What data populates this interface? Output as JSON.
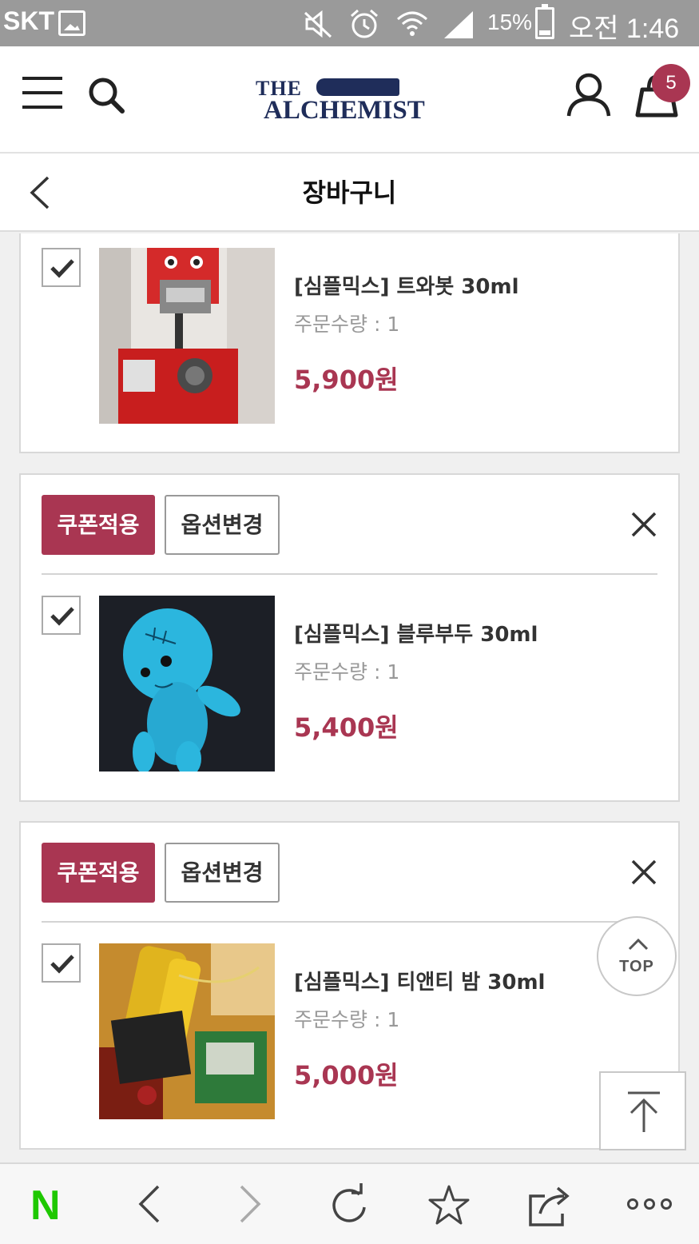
{
  "status_bar": {
    "carrier": "SKT",
    "battery_percent": "15%",
    "time": "오전 1:46",
    "icons": [
      "gallery-icon",
      "mute-icon",
      "alarm-icon",
      "wifi-icon",
      "signal-icon",
      "battery-icon"
    ]
  },
  "header": {
    "logo_line1": "THE",
    "logo_line2": "ALCHEMIST",
    "cart_count": "5",
    "icons": [
      "menu-icon",
      "search-icon",
      "user-icon",
      "cart-icon"
    ]
  },
  "page": {
    "title": "장바구니"
  },
  "cart": {
    "coupon_label": "쿠폰적용",
    "option_label": "옵션변경",
    "items": [
      {
        "name": "[심플믹스] 트와봇 30ml",
        "quantity": "주문수량 : 1",
        "price": "5,900원",
        "checked": true,
        "image": "red-robot"
      },
      {
        "name": "[심플믹스] 블루부두 30ml",
        "quantity": "주문수량 : 1",
        "price": "5,400원",
        "checked": true,
        "image": "blue-voodoo-doll"
      },
      {
        "name": "[심플믹스] 티앤티 밤 30ml",
        "quantity": "주문수량 : 1",
        "price": "5,000원",
        "checked": true,
        "image": "battery-circuit"
      }
    ]
  },
  "floating": {
    "top_label": "TOP"
  },
  "colors": {
    "accent": "#a93652",
    "status_bar": "#9a9a9a",
    "naver_green": "#1ec800"
  }
}
